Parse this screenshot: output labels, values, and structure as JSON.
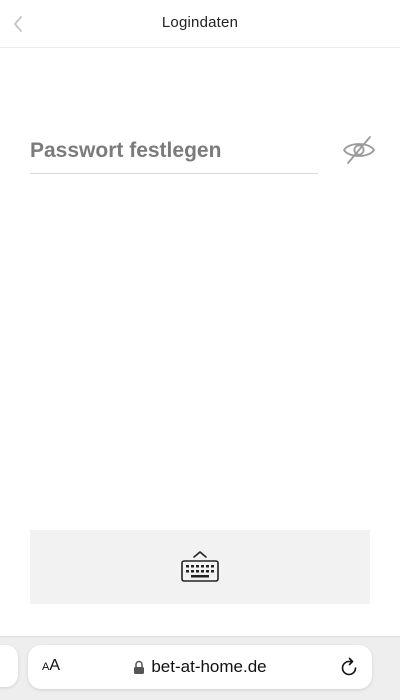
{
  "header": {
    "title": "Logindaten"
  },
  "form": {
    "password_placeholder": "Passwort festlegen",
    "password_value": ""
  },
  "icons": {
    "back": "chevron-left-icon",
    "visibility": "eye-off-icon",
    "keyboard": "keyboard-icon",
    "lock": "lock-icon",
    "reload": "reload-icon"
  },
  "browser": {
    "text_size_label_small": "A",
    "text_size_label_large": "A",
    "url": "bet-at-home.de"
  },
  "colors": {
    "text_primary": "#222222",
    "placeholder": "#7b7b7b",
    "divider": "#d9d9d9",
    "keyboard_panel_bg": "#f2f2f2",
    "browser_bar_bg": "#eeeeee"
  }
}
